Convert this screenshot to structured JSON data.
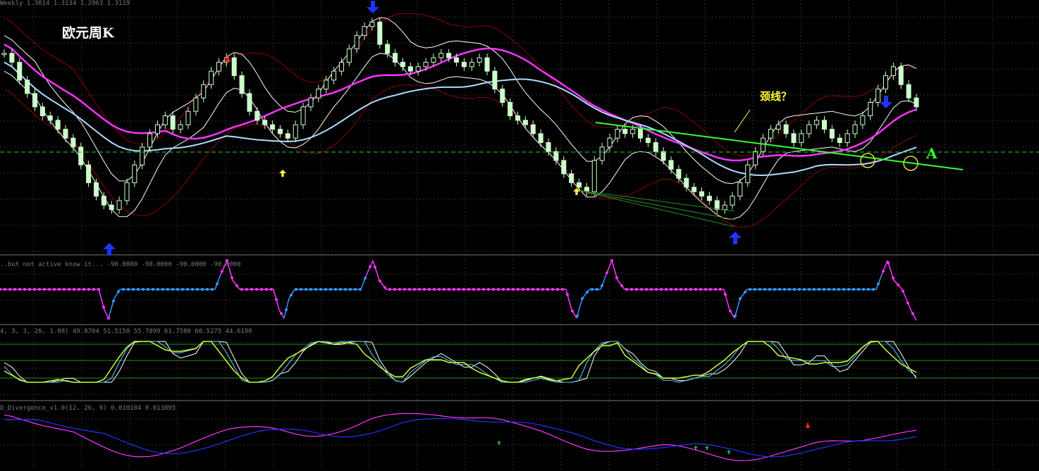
{
  "chart_data": {
    "type": "line",
    "title": "欧元周K",
    "annotations": {
      "neckline_label": "颈线？",
      "point_label": "A"
    },
    "panels": [
      {
        "name": "price",
        "header": "Weekly 1.3014 1.3134 1.2963 1.3119"
      },
      {
        "name": "oscillator-1",
        "header": "..but not active know it... -90.0000 -90.0000 -90.0000 -90.0000"
      },
      {
        "name": "oscillator-2",
        "header": "4, 3, 3, 26, 1.08) 49.8704 51.5150 55.7899 61.7580 60.5275 44.6190"
      },
      {
        "name": "divergence",
        "header": "D_Divergence_v1.0(12, 26, 9) 0.010104 0.013895"
      }
    ],
    "candles": {
      "y_range": [
        0,
        100
      ],
      "values": [
        84,
        80,
        72,
        66,
        60,
        56,
        54,
        50,
        46,
        42,
        34,
        26,
        20,
        16,
        14,
        18,
        26,
        34,
        42,
        48,
        52,
        56,
        50,
        52,
        58,
        64,
        70,
        76,
        80,
        82,
        74,
        66,
        58,
        54,
        52,
        50,
        48,
        46,
        52,
        60,
        64,
        68,
        72,
        76,
        80,
        86,
        92,
        96,
        98,
        88,
        84,
        80,
        78,
        76,
        78,
        80,
        82,
        84,
        82,
        80,
        78,
        80,
        82,
        76,
        68,
        62,
        56,
        54,
        52,
        48,
        44,
        40,
        36,
        30,
        26,
        24,
        22,
        36,
        42,
        46,
        50,
        48,
        50,
        46,
        44,
        40,
        36,
        32,
        28,
        24,
        22,
        20,
        18,
        14,
        16,
        20,
        26,
        34,
        40,
        46,
        50,
        52,
        48,
        44,
        48,
        52,
        54,
        50,
        46,
        44,
        48,
        52,
        56,
        62,
        68,
        74,
        78,
        70,
        64,
        60
      ]
    },
    "colors": {
      "candle": "#ccffcc",
      "bands_inner": "#ffffff",
      "bands_outer": "#8b0000",
      "ma_slow": "#ff33ff",
      "ma_fast": "#aaddff",
      "neckline": "#33ff33",
      "signal_up": "#ffff33",
      "signal_down_big": "#2233ff",
      "signal_down_red": "#ff2222"
    }
  }
}
